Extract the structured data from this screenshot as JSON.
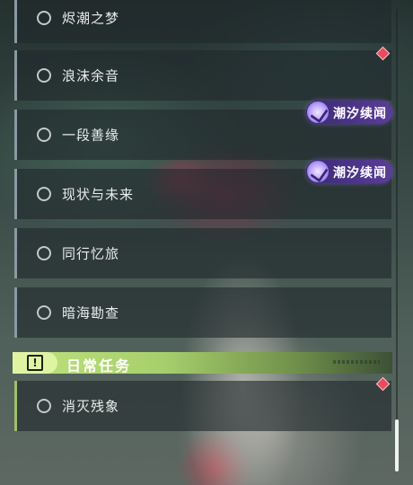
{
  "quests": [
    {
      "label": "烬潮之梦"
    },
    {
      "label": "浪沫余音"
    },
    {
      "label": "一段善缘"
    },
    {
      "label": "现状与未来"
    },
    {
      "label": "同行忆旅"
    },
    {
      "label": "暗海勘查"
    }
  ],
  "tags": [
    {
      "text": "潮汐续闻"
    },
    {
      "text": "潮汐续闻"
    }
  ],
  "daily_section": {
    "icon": "!",
    "title": "日常任务"
  },
  "daily_quests": [
    {
      "label": "消灭残象"
    }
  ],
  "colors": {
    "quest_accent": "#8a9aa3",
    "daily_accent": "#9fc16a",
    "tag_bg": "#4b3489",
    "marker": "#e84b5c"
  }
}
